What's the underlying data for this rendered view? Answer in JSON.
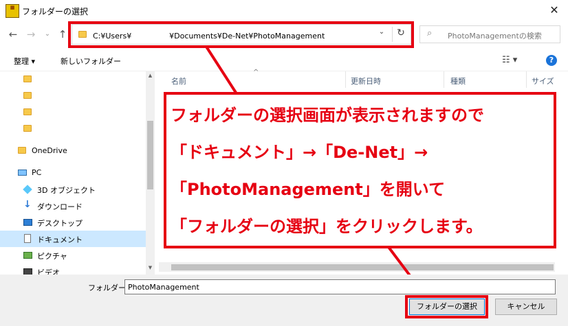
{
  "window": {
    "title": "フォルダーの選択",
    "app_icon_text": "",
    "close_label": "✕"
  },
  "nav": {
    "back": "←",
    "forward": "→",
    "dropdown": "⌄",
    "up": "↑"
  },
  "address": {
    "path": "C:¥Users¥　　　　　¥Documents¥De-Net¥PhotoManagement",
    "dropdown": "⌄",
    "refresh": "↻"
  },
  "search": {
    "placeholder": "PhotoManagementの検索",
    "icon": "⌕"
  },
  "toolbar": {
    "organize": "整理 ▾",
    "new_folder": "新しいフォルダー",
    "view_icon": "☷ ▾",
    "help": "?"
  },
  "sidebar": {
    "items": [
      {
        "label": "",
        "icon": "folder-icon"
      },
      {
        "label": "",
        "icon": "folder-icon"
      },
      {
        "label": "",
        "icon": "folder-icon"
      },
      {
        "label": "",
        "icon": "folder-icon"
      },
      {
        "label": "OneDrive",
        "icon": "folder-icon"
      },
      {
        "label": "PC",
        "icon": "pc-icon"
      },
      {
        "label": "3D オブジェクト",
        "icon": "cube-icon"
      },
      {
        "label": "ダウンロード",
        "icon": "download-icon"
      },
      {
        "label": "デスクトップ",
        "icon": "desktop-icon"
      },
      {
        "label": "ドキュメント",
        "icon": "document-icon"
      },
      {
        "label": "ピクチャ",
        "icon": "picture-icon"
      },
      {
        "label": "ビデオ",
        "icon": "video-icon"
      }
    ],
    "selected": "ドキュメント"
  },
  "columns": {
    "name": "名前",
    "date": "更新日時",
    "type": "種類",
    "size": "サイズ"
  },
  "annotation": {
    "lines": [
      "フォルダーの選択画面が表示されますので",
      "「ドキュメント」→「De-Net」→",
      "「PhotoManagement」を開いて",
      "「フォルダーの選択」をクリックします。"
    ]
  },
  "footer": {
    "folder_label": "フォルダー:",
    "folder_value": "PhotoManagement",
    "select_button": "フォルダーの選択",
    "cancel_button": "キャンセル"
  },
  "colors": {
    "highlight": "#e60012",
    "selection": "#cce8ff",
    "accent": "#0078d7"
  }
}
